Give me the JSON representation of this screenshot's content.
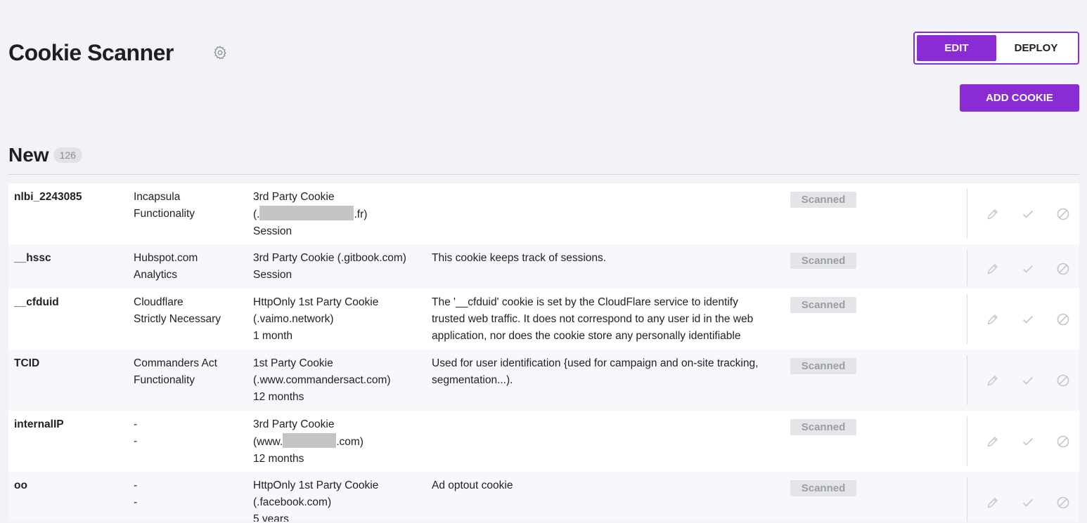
{
  "header": {
    "title": "Cookie Scanner",
    "settings_icon": "gear-icon",
    "mode_edit": "EDIT",
    "mode_deploy": "DEPLOY",
    "add_cookie": "ADD COOKIE",
    "accent_color": "#8a2bd3"
  },
  "section": {
    "title": "New",
    "count": "126"
  },
  "cookies": [
    {
      "name": "nlbi_2243085",
      "provider_line1": "Incapsula",
      "provider_line2": "Functionality",
      "type_line1": "3rd Party Cookie",
      "type_line2_prefix": "(.",
      "type_line2_suffix": ".fr)",
      "type_line3": "Session",
      "description_line1": "",
      "description_line2": "",
      "description_line3": "",
      "status": "Scanned"
    },
    {
      "name": "__hssc",
      "provider_line1": "Hubspot.com",
      "provider_line2": "Analytics",
      "type_line1": "3rd Party Cookie (.gitbook.com)",
      "type_line2": "Session",
      "description_line1": "This cookie keeps track of sessions.",
      "status": "Scanned"
    },
    {
      "name": "__cfduid",
      "provider_line1": "Cloudflare",
      "provider_line2": "Strictly Necessary",
      "type_line1": "HttpOnly 1st Party Cookie",
      "type_line2": "(.vaimo.network)",
      "type_line3": "1 month",
      "description_line1": "The '__cfduid' cookie is set by the CloudFlare service to identify",
      "description_line2": "trusted web traffic. It does not correspond to any user id in the web",
      "description_line3": "application, nor does the cookie store any personally identifiable",
      "status": "Scanned"
    },
    {
      "name": "TCID",
      "provider_line1": "Commanders Act",
      "provider_line2": "Functionality",
      "type_line1": "1st Party Cookie",
      "type_line2": "(.www.commandersact.com)",
      "type_line3": "12 months",
      "description_line1": "Used for user identification {used for campaign and on-site tracking,",
      "description_line2": "segmentation...).",
      "status": "Scanned"
    },
    {
      "name": "internalIP",
      "provider_line1": "-",
      "provider_line2": "-",
      "type_line1": "3rd Party Cookie",
      "type_line2_prefix": "(www.",
      "type_line2_suffix": ".com)",
      "type_line3": "12 months",
      "status": "Scanned"
    },
    {
      "name": "oo",
      "provider_line1": "-",
      "provider_line2": "-",
      "type_line1": "HttpOnly 1st Party Cookie",
      "type_line2": "(.facebook.com)",
      "type_line3": "5 years",
      "description_line1": "Ad optout cookie",
      "status": "Scanned"
    }
  ],
  "row_actions": [
    "pencil-icon",
    "check-icon",
    "block-icon"
  ]
}
